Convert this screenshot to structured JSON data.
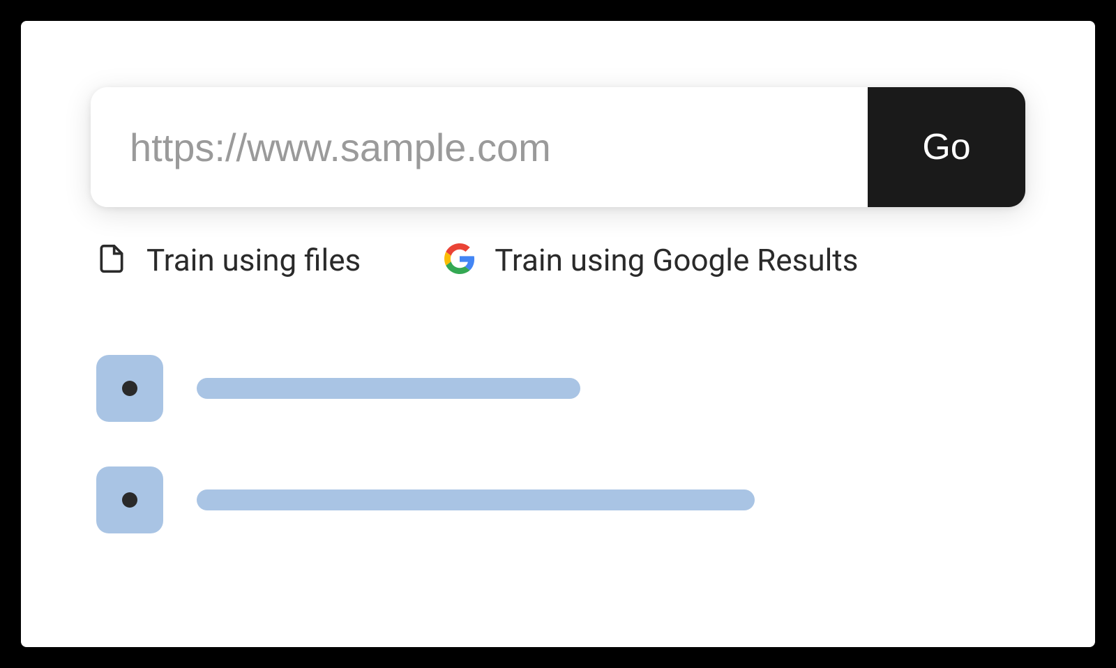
{
  "url_bar": {
    "placeholder": "https://www.sample.com",
    "value": "",
    "go_label": "Go"
  },
  "options": {
    "files_label": "Train using files",
    "google_label": "Train using Google Results"
  },
  "results": [
    {
      "placeholder": true
    },
    {
      "placeholder": true
    }
  ]
}
